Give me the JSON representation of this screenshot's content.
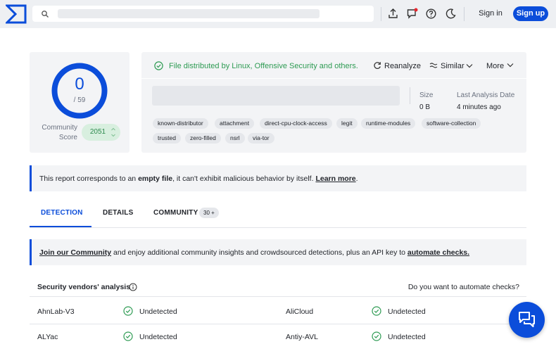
{
  "header": {
    "logo": "virustotal-logo",
    "search_placeholder": "",
    "icons": [
      "upload-icon",
      "notification-icon",
      "help-icon",
      "dark-mode-icon"
    ],
    "signin_label": "Sign in",
    "signup_label": "Sign up"
  },
  "score": {
    "detections": "0",
    "total": "/ 59",
    "community_label_1": "Community",
    "community_label_2": "Score",
    "community_value": "2051"
  },
  "file": {
    "distribution": "File distributed by Linux, Offensive Security and others.",
    "reanalyze_label": "Reanalyze",
    "similar_label": "Similar",
    "more_label": "More",
    "size_label": "Size",
    "size_value": "0 B",
    "last_analysis_label": "Last Analysis Date",
    "last_analysis_value": "4 minutes ago",
    "tags_row1": [
      "known-distributor",
      "attachment",
      "direct-cpu-clock-access",
      "legit",
      "runtime-modules",
      "software-collection"
    ],
    "tags_row2": [
      "trusted",
      "zero-filled",
      "nsrl",
      "via-tor"
    ]
  },
  "notice": {
    "prefix": "This report corresponds to an ",
    "bold": "empty file",
    "middle": ", it can't exhibit malicious behavior by itself. ",
    "link": "Learn more",
    "suffix": "."
  },
  "tabs": {
    "detection": "DETECTION",
    "details": "DETAILS",
    "community": "COMMUNITY",
    "community_badge": "30 +"
  },
  "join": {
    "link1": "Join our Community",
    "middle": " and enjoy additional community insights and crowdsourced detections, plus an API key to ",
    "link2": "automate checks."
  },
  "vendors": {
    "title": "Security vendors' analysis",
    "automate_question": "Do you want to automate checks?",
    "rows": [
      {
        "left_name": "AhnLab-V3",
        "left_status": "Undetected",
        "right_name": "AliCloud",
        "right_status": "Undetected"
      },
      {
        "left_name": "ALYac",
        "left_status": "Undetected",
        "right_name": "Antiy-AVL",
        "right_status": "Undetected"
      }
    ]
  },
  "colors": {
    "accent": "#0b4dda",
    "success": "#2e9b53",
    "panel": "#f3f4f6"
  }
}
